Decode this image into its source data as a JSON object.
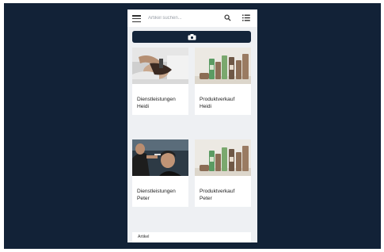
{
  "search": {
    "placeholder": "Artikel suchen..."
  },
  "cards": [
    {
      "line1": "Dienstleistungen",
      "line2": "Heidi",
      "image": "hair-service-photo"
    },
    {
      "line1": "Produktverkauf",
      "line2": "Heidi",
      "image": "hair-products-photo"
    },
    {
      "line1": "Dienstleistungen",
      "line2": "Peter",
      "image": "barber-service-photo"
    },
    {
      "line1": "Produktverkauf",
      "line2": "Peter",
      "image": "hair-products-photo"
    }
  ],
  "section": {
    "label": "Artikel"
  },
  "colors": {
    "background": "#122237",
    "camera_button": "#13243a",
    "screen": "#eef0f3"
  },
  "icons": [
    "menu-icon",
    "search-icon",
    "list-view-icon",
    "camera-switch-icon"
  ]
}
